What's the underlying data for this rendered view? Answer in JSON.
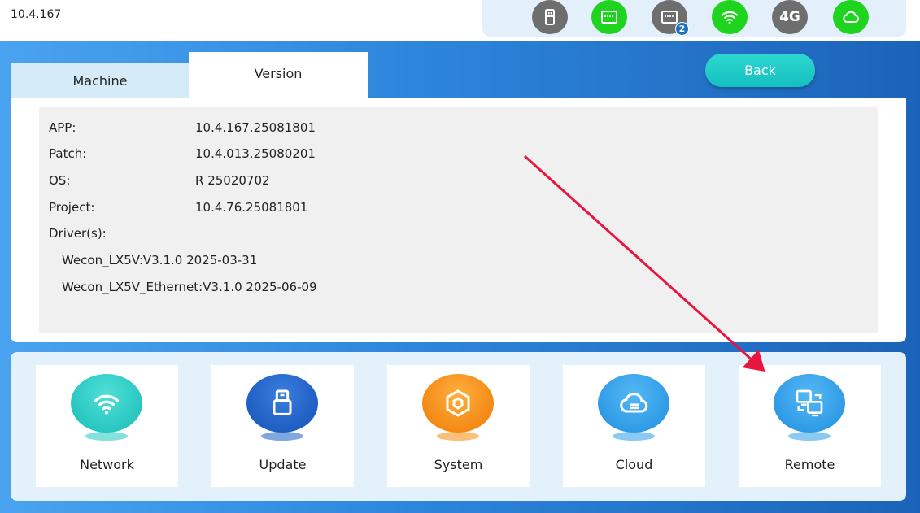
{
  "header": {
    "ip": "10.4.167",
    "status_icons": [
      {
        "name": "usb-icon",
        "color": "#6e6e6e"
      },
      {
        "name": "ethernet-icon",
        "color": "#1fd41f"
      },
      {
        "name": "ethernet-2-icon",
        "color": "#6e6e6e",
        "badge": "2"
      },
      {
        "name": "wifi-icon",
        "color": "#1fd41f"
      },
      {
        "name": "4g-icon",
        "color": "#6e6e6e",
        "label": "4G"
      },
      {
        "name": "cloud-icon",
        "color": "#1fd41f"
      }
    ]
  },
  "tabs": {
    "machine": "Machine",
    "version": "Version"
  },
  "back_label": "Back",
  "version_info": {
    "app_key": "APP:",
    "app_val": "10.4.167.25081801",
    "patch_key": "Patch:",
    "patch_val": "10.4.013.25080201",
    "os_key": "OS:",
    "os_val": "R 25020702",
    "project_key": "Project:",
    "project_val": "10.4.76.25081801",
    "drivers_key": "Driver(s):",
    "drivers": [
      "Wecon_LX5V:V3.1.0 2025-03-31",
      "Wecon_LX5V_Ethernet:V3.1.0 2025-06-09"
    ]
  },
  "functions": [
    {
      "label": "Network",
      "icon": "wifi-icon",
      "color": "#1ec8c2"
    },
    {
      "label": "Update",
      "icon": "usb-drive-icon",
      "color": "#1a5fc4"
    },
    {
      "label": "System",
      "icon": "hexagon-gear-icon",
      "color": "#f58a0a"
    },
    {
      "label": "Cloud",
      "icon": "cloud-icon",
      "color": "#2a9ee8"
    },
    {
      "label": "Remote",
      "icon": "remote-screens-icon",
      "color": "#2a9ee8"
    }
  ],
  "annotation_color": "#e8163c"
}
